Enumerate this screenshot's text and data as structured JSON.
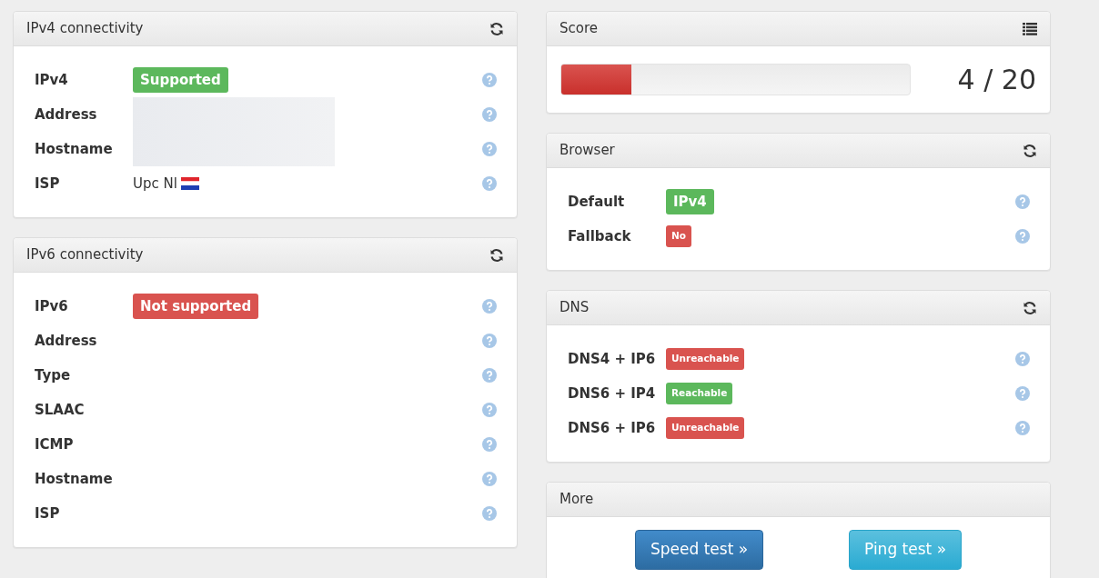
{
  "left_panels": [
    {
      "title": "IPv4 connectivity",
      "rows": [
        {
          "label": "IPv4",
          "value": {
            "kind": "label",
            "text": "Supported",
            "color": "#5cb85c"
          }
        },
        {
          "label": "Address",
          "value": {
            "kind": "redacted"
          }
        },
        {
          "label": "Hostname",
          "value": {
            "kind": "redacted"
          }
        },
        {
          "label": "ISP",
          "value": {
            "kind": "text",
            "text": "Upc Nl",
            "flag": true
          }
        }
      ]
    },
    {
      "title": "IPv6 connectivity",
      "rows": [
        {
          "label": "IPv6",
          "value": {
            "kind": "label",
            "text": "Not supported",
            "color": "#d9534f"
          }
        },
        {
          "label": "Address",
          "value": {
            "kind": "none"
          }
        },
        {
          "label": "Type",
          "value": {
            "kind": "none"
          }
        },
        {
          "label": "SLAAC",
          "value": {
            "kind": "none"
          }
        },
        {
          "label": "ICMP",
          "value": {
            "kind": "none"
          }
        },
        {
          "label": "Hostname",
          "value": {
            "kind": "none"
          }
        },
        {
          "label": "ISP",
          "value": {
            "kind": "none"
          }
        }
      ]
    }
  ],
  "score": {
    "title": "Score",
    "level": 0.2,
    "reading": "4 / 20"
  },
  "right_panels": [
    {
      "title": "Browser",
      "rows": [
        {
          "label": "Default",
          "value": {
            "kind": "label",
            "text": "IPv4",
            "color": "#5cb85c"
          }
        },
        {
          "label": "Fallback",
          "value": {
            "kind": "tag",
            "text": "No",
            "color": "#d9534f"
          }
        }
      ]
    },
    {
      "title": "DNS",
      "rows": [
        {
          "label": "DNS4 + IP6",
          "value": {
            "kind": "tag",
            "text": "Unreachable",
            "color": "#d9534f"
          }
        },
        {
          "label": "DNS6 + IP4",
          "value": {
            "kind": "tag",
            "text": "Reachable",
            "color": "#5cb85c"
          }
        },
        {
          "label": "DNS6 + IP6",
          "value": {
            "kind": "tag",
            "text": "Unreachable",
            "color": "#d9534f"
          }
        }
      ]
    }
  ],
  "more": {
    "title": "More",
    "buttons": [
      "Speed test »",
      "Ping test »"
    ]
  }
}
